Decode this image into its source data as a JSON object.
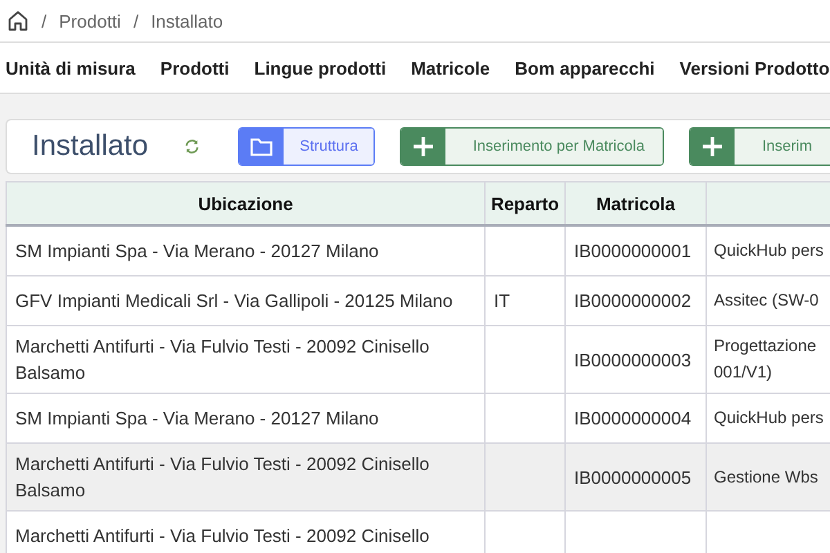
{
  "breadcrumb": {
    "separator": "/",
    "items": [
      "Prodotti",
      "Installato"
    ]
  },
  "nav": [
    "Unità di misura",
    "Prodotti",
    "Lingue prodotti",
    "Matricole",
    "Bom apparecchi",
    "Versioni Prodotto"
  ],
  "toolbar": {
    "title": "Installato",
    "buttons": [
      {
        "kind": "folder",
        "label": "Struttura"
      },
      {
        "kind": "add",
        "label": "Inserimento per Matricola"
      },
      {
        "kind": "add",
        "label": "Inserim"
      }
    ]
  },
  "table": {
    "columns": [
      "Ubicazione",
      "Reparto",
      "Matricola"
    ],
    "rows": [
      {
        "cells": [
          "SM Impianti Spa - Via Merano - 20127 Milano",
          "",
          "IB0000000001",
          "QuickHub pers"
        ],
        "highlighted": false
      },
      {
        "cells": [
          "GFV Impianti Medicali Srl - Via Gallipoli - 20125 Milano",
          "IT",
          "IB0000000002",
          "Assitec (SW-0"
        ],
        "highlighted": false
      },
      {
        "cells": [
          "Marchetti Antifurti - Via Fulvio Testi - 20092 Cinisello Balsamo",
          "",
          "IB0000000003",
          "Progettazione\n001/V1)"
        ],
        "highlighted": false
      },
      {
        "cells": [
          "SM Impianti Spa - Via Merano - 20127 Milano",
          "",
          "IB0000000004",
          "QuickHub pers"
        ],
        "highlighted": false
      },
      {
        "cells": [
          "Marchetti Antifurti - Via Fulvio Testi - 20092 Cinisello Balsamo",
          "",
          "IB0000000005",
          "Gestione Wbs"
        ],
        "highlighted": true
      },
      {
        "cells": [
          "Marchetti Antifurti - Via Fulvio Testi - 20092 Cinisello",
          "",
          "",
          ""
        ],
        "highlighted": false
      }
    ]
  }
}
